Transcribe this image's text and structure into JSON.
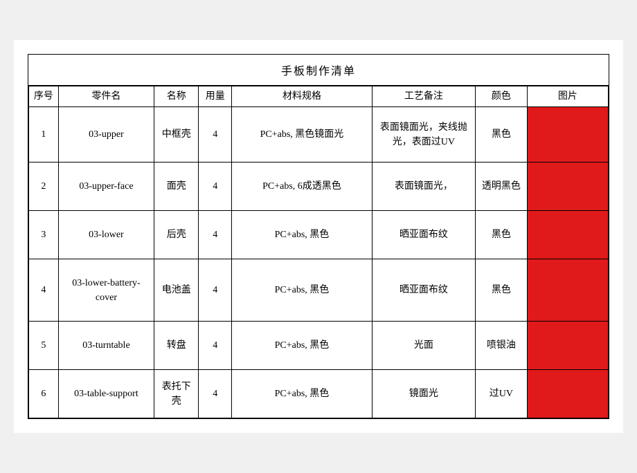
{
  "title": "手板制作清单",
  "headers": {
    "seq": "序号",
    "part": "零件名",
    "name": "名称",
    "qty": "用量",
    "spec": "材料规格",
    "process": "工艺备注",
    "color": "颜色",
    "image": "图片"
  },
  "rows": [
    {
      "seq": "1",
      "part": "03-upper",
      "name": "中框壳",
      "qty": "4",
      "spec": "PC+abs, 黑色镜面光",
      "process": "表面镜面光，夹线抛光，表面过UV",
      "color": "黑色"
    },
    {
      "seq": "2",
      "part": "03-upper-face",
      "name": "面壳",
      "qty": "4",
      "spec": "PC+abs, 6成透黑色",
      "process": "表面镜面光，",
      "color": "透明黑色"
    },
    {
      "seq": "3",
      "part": "03-lower",
      "name": "后壳",
      "qty": "4",
      "spec": "PC+abs, 黑色",
      "process": "晒亚面布纹",
      "color": "黑色"
    },
    {
      "seq": "4",
      "part": "03-lower-battery-cover",
      "name": "电池盖",
      "qty": "4",
      "spec": "PC+abs, 黑色",
      "process": "晒亚面布纹",
      "color": "黑色"
    },
    {
      "seq": "5",
      "part": "03-turntable",
      "name": "转盘",
      "qty": "4",
      "spec": "PC+abs, 黑色",
      "process": "光面",
      "color": "喷银油"
    },
    {
      "seq": "6",
      "part": "03-table-support",
      "name": "表托下壳",
      "qty": "4",
      "spec": "PC+abs, 黑色",
      "process": "镜面光",
      "color": "过UV"
    }
  ]
}
